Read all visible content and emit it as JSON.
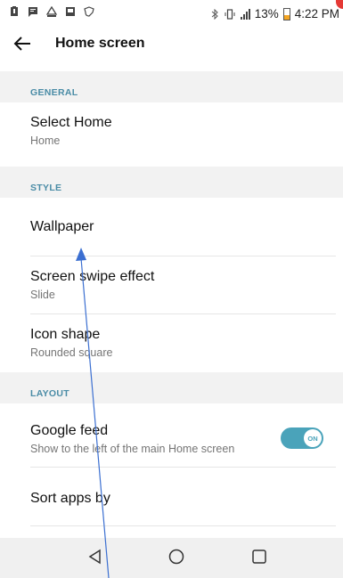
{
  "status_bar": {
    "battery": "13%",
    "time": "4:22 PM"
  },
  "app_bar": {
    "title": "Home screen",
    "back_icon": "back-arrow-icon"
  },
  "sections": {
    "general": {
      "header": "GENERAL",
      "select_home": {
        "title": "Select Home",
        "subtitle": "Home"
      }
    },
    "style": {
      "header": "STYLE",
      "wallpaper": {
        "title": "Wallpaper"
      },
      "screen_swipe": {
        "title": "Screen swipe effect",
        "subtitle": "Slide"
      },
      "icon_shape": {
        "title": "Icon shape",
        "subtitle": "Rounded square"
      }
    },
    "layout": {
      "header": "LAYOUT",
      "google_feed": {
        "title": "Google feed",
        "subtitle": "Show to the left of the main Home screen",
        "toggle": "ON"
      },
      "sort_apps": {
        "title": "Sort apps by"
      }
    }
  },
  "colors": {
    "accent": "#4aa3ba",
    "header_text": "#4a8ca6",
    "section_bg": "#f2f2f2",
    "annotation": "#3b6fd1"
  }
}
